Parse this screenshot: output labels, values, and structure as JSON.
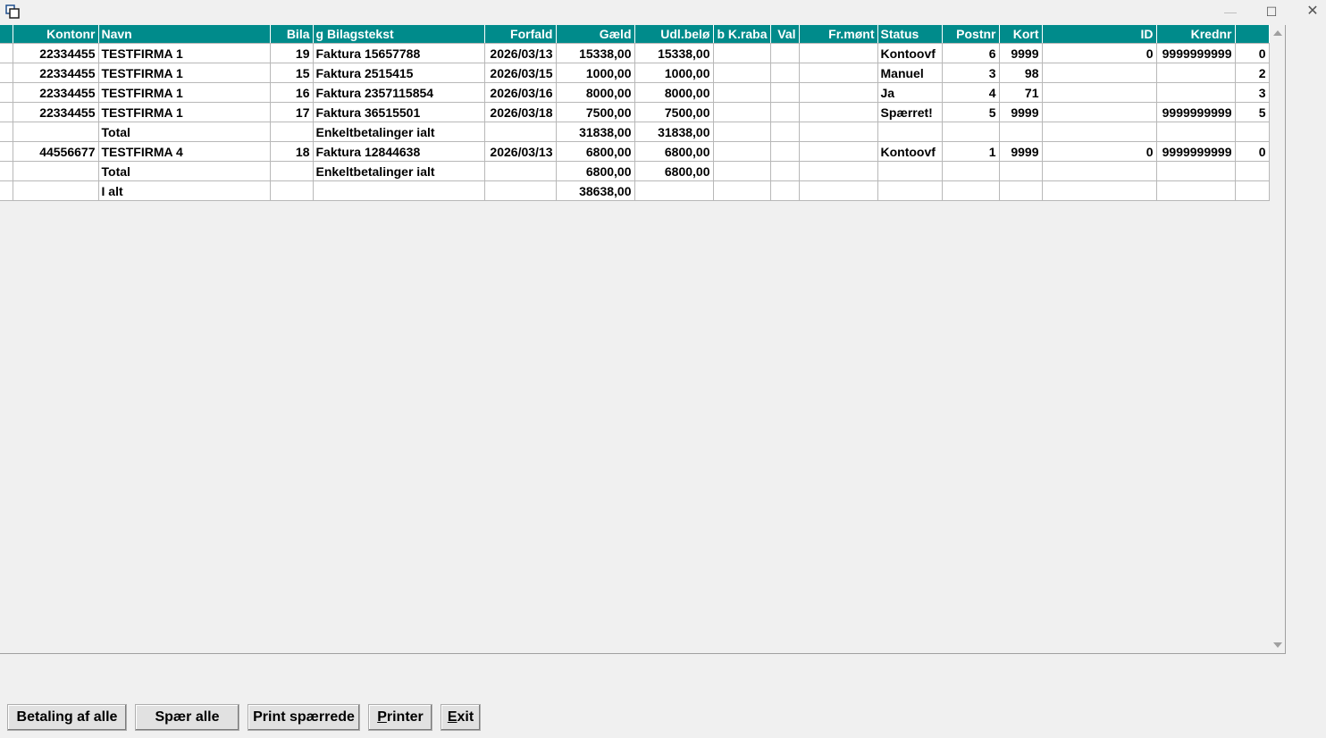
{
  "window": {
    "minimize_glyph": "—",
    "maximize_glyph": "☐",
    "close_glyph": "✕"
  },
  "grid": {
    "columns": [
      "Kontonr",
      "Navn",
      "Bila",
      "g Bilagstekst",
      "Forfald",
      "Gæld",
      "Udl.belø",
      "b K.raba",
      "Val",
      "Fr.mønt",
      "Status",
      "Postnr",
      "Kort",
      "ID",
      "Krednr",
      ""
    ],
    "rows": [
      [
        "22334455",
        "TESTFIRMA 1",
        "19",
        "Faktura 15657788",
        "2026/03/13",
        "15338,00",
        "15338,00",
        "",
        "",
        "",
        "Kontoovf",
        "6",
        "9999",
        "0",
        "9999999999",
        "0"
      ],
      [
        "22334455",
        "TESTFIRMA 1",
        "15",
        "Faktura 2515415",
        "2026/03/15",
        "1000,00",
        "1000,00",
        "",
        "",
        "",
        "Manuel",
        "3",
        "98",
        "",
        "",
        "2"
      ],
      [
        "22334455",
        "TESTFIRMA 1",
        "16",
        "Faktura 2357115854",
        "2026/03/16",
        "8000,00",
        "8000,00",
        "",
        "",
        "",
        "Ja",
        "4",
        "71",
        "",
        "",
        "3"
      ],
      [
        "22334455",
        "TESTFIRMA 1",
        "17",
        "Faktura 36515501",
        "2026/03/18",
        "7500,00",
        "7500,00",
        "",
        "",
        "",
        "Spærret!",
        "5",
        "9999",
        "",
        "9999999999",
        "5"
      ],
      [
        "",
        "Total",
        "",
        "Enkeltbetalinger ialt",
        "",
        "31838,00",
        "31838,00",
        "",
        "",
        "",
        "",
        "",
        "",
        "",
        "",
        ""
      ],
      [
        "44556677",
        "TESTFIRMA 4",
        "18",
        "Faktura 12844638",
        "2026/03/13",
        "6800,00",
        "6800,00",
        "",
        "",
        "",
        "Kontoovf",
        "1",
        "9999",
        "0",
        "9999999999",
        "0"
      ],
      [
        "",
        "Total",
        "",
        "Enkeltbetalinger ialt",
        "",
        "6800,00",
        "6800,00",
        "",
        "",
        "",
        "",
        "",
        "",
        "",
        "",
        ""
      ],
      [
        "",
        "I alt",
        "",
        "",
        "",
        "38638,00",
        "",
        "",
        "",
        "",
        "",
        "",
        "",
        "",
        "",
        ""
      ]
    ]
  },
  "buttons": {
    "pay_all": "Betaling af alle",
    "block_all": "Spær alle",
    "print_blocked": "Print spærrede",
    "printer_u": "P",
    "printer_rest": "rinter",
    "exit_u": "E",
    "exit_rest": "xit"
  }
}
